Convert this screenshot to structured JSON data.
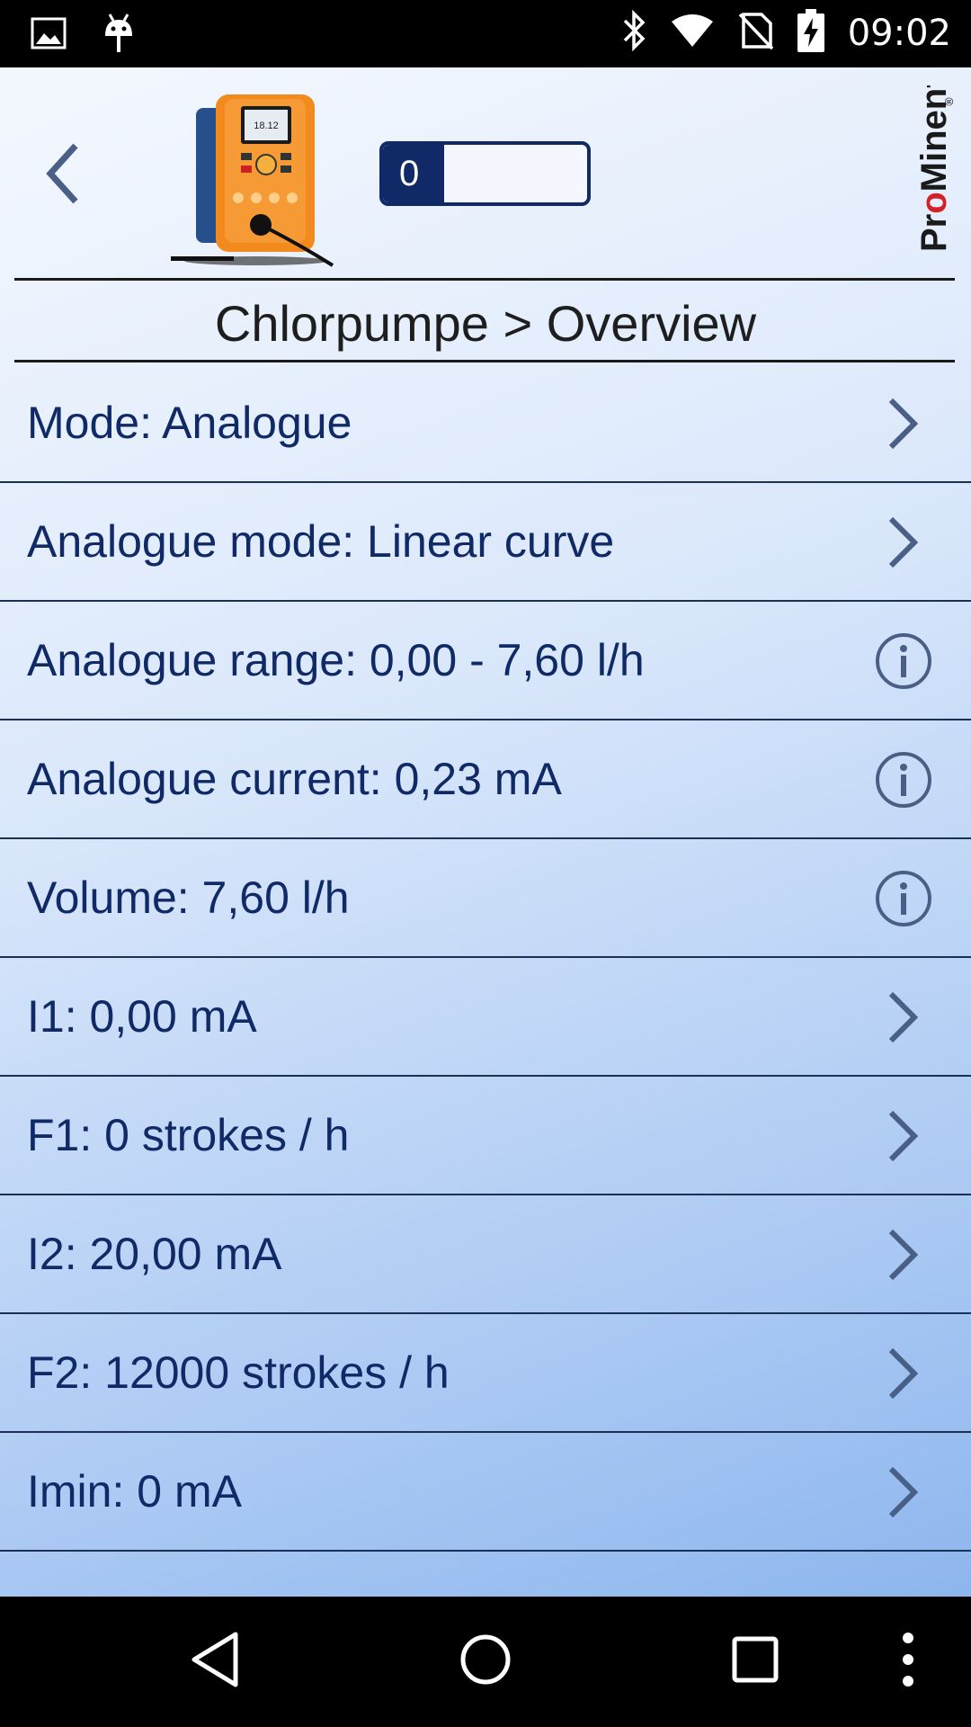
{
  "status_bar": {
    "time": "09:02",
    "left_icons": [
      "image-icon",
      "android-icon"
    ],
    "right_icons": [
      "bluetooth-icon",
      "wifi-icon",
      "no-sim-icon",
      "battery-charging-icon"
    ]
  },
  "header": {
    "back_icon": "chevron-left-icon",
    "device_image": "dosing-pump-image",
    "progress": {
      "value_label": "0",
      "fill_fraction": 0.3
    },
    "brand": "ProMinent",
    "page_title": "Chlorpumpe > Overview"
  },
  "menu": {
    "items": [
      {
        "label": "Mode: Analogue",
        "icon": "chevron-right-icon"
      },
      {
        "label": "Analogue mode: Linear curve",
        "icon": "chevron-right-icon"
      },
      {
        "label": "Analogue range: 0,00 - 7,60 l/h",
        "icon": "info-icon"
      },
      {
        "label": "Analogue current: 0,23 mA",
        "icon": "info-icon"
      },
      {
        "label": "Volume: 7,60 l/h",
        "icon": "info-icon"
      },
      {
        "label": "I1: 0,00 mA",
        "icon": "chevron-right-icon"
      },
      {
        "label": "F1: 0 strokes / h",
        "icon": "chevron-right-icon"
      },
      {
        "label": "I2: 20,00 mA",
        "icon": "chevron-right-icon"
      },
      {
        "label": "F2: 12000 strokes / h",
        "icon": "chevron-right-icon"
      },
      {
        "label": "Imin: 0 mA",
        "icon": "chevron-right-icon"
      }
    ]
  },
  "nav_bar": {
    "buttons": [
      "back-triangle-icon",
      "home-circle-icon",
      "recents-square-icon",
      "more-vert-icon"
    ]
  },
  "colors": {
    "accent": "#0f2a66",
    "icon_gray_blue": "#4a5f86",
    "brand_red": "#d42026"
  }
}
